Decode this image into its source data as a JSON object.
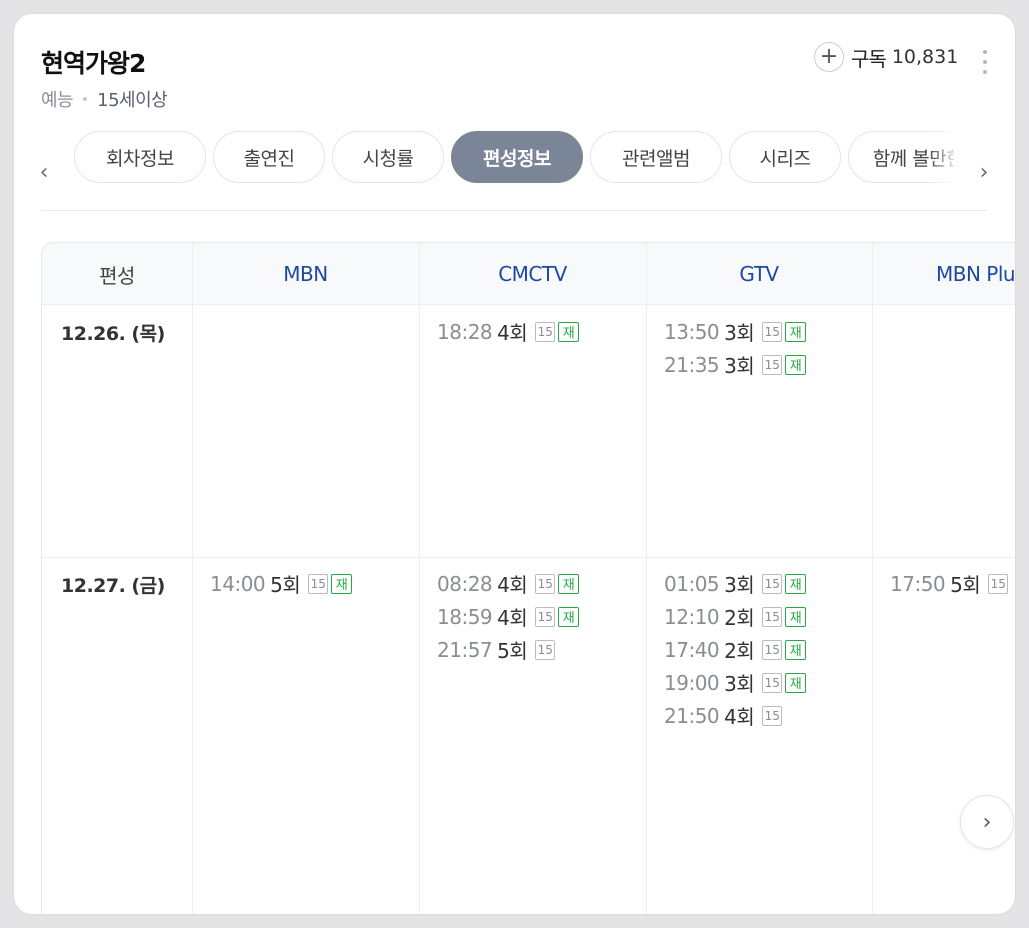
{
  "program": {
    "title": "현역가왕2",
    "genre": "예능",
    "age_rating": "15세이상",
    "subscribe_label": "구독",
    "subscribe_count": "10,831"
  },
  "icons": {
    "plus": "+",
    "prev": "‹",
    "next": "›",
    "scroll_next": "›"
  },
  "tabs": [
    {
      "label": "회차정보",
      "active": false
    },
    {
      "label": "출연진",
      "active": false
    },
    {
      "label": "시청률",
      "active": false
    },
    {
      "label": "편성정보",
      "active": true
    },
    {
      "label": "관련앨범",
      "active": false
    },
    {
      "label": "시리즈",
      "active": false
    },
    {
      "label": "함께 볼만한",
      "active": false
    }
  ],
  "schedule": {
    "header_label": "편성",
    "channels": [
      "MBN",
      "CMCTV",
      "GTV",
      "MBN Plus"
    ],
    "badges": {
      "age": "15",
      "rerun": "재"
    },
    "rows": [
      {
        "date": "12.26. (목)",
        "cells": [
          [],
          [
            {
              "time": "18:28",
              "episode": "4회",
              "rerun": true
            }
          ],
          [
            {
              "time": "13:50",
              "episode": "3회",
              "rerun": true
            },
            {
              "time": "21:35",
              "episode": "3회",
              "rerun": true
            }
          ],
          []
        ]
      },
      {
        "date": "12.27. (금)",
        "cells": [
          [
            {
              "time": "14:00",
              "episode": "5회",
              "rerun": true
            }
          ],
          [
            {
              "time": "08:28",
              "episode": "4회",
              "rerun": true
            },
            {
              "time": "18:59",
              "episode": "4회",
              "rerun": true
            },
            {
              "time": "21:57",
              "episode": "5회",
              "rerun": false
            }
          ],
          [
            {
              "time": "01:05",
              "episode": "3회",
              "rerun": true
            },
            {
              "time": "12:10",
              "episode": "2회",
              "rerun": true
            },
            {
              "time": "17:40",
              "episode": "2회",
              "rerun": true
            },
            {
              "time": "19:00",
              "episode": "3회",
              "rerun": true
            },
            {
              "time": "21:50",
              "episode": "4회",
              "rerun": false
            }
          ],
          [
            {
              "time": "17:50",
              "episode": "5회",
              "rerun": false
            }
          ]
        ]
      }
    ]
  }
}
